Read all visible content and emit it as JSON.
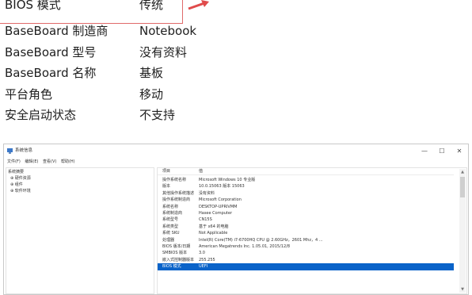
{
  "zoom": {
    "rows": [
      {
        "key": "BIOS 模式",
        "value": "传统"
      },
      {
        "key": "BaseBoard 制造商",
        "value": "Notebook"
      },
      {
        "key": "BaseBoard 型号",
        "value": "没有资料"
      },
      {
        "key": "BaseBoard 名称",
        "value": "基板"
      },
      {
        "key": "平台角色",
        "value": "移动"
      },
      {
        "key": "安全启动状态",
        "value": "不支持"
      }
    ],
    "highlight_color": "#e06a6a"
  },
  "window": {
    "title": "系统信息",
    "controls": {
      "minimize": "—",
      "maximize": "☐",
      "close": "✕"
    },
    "menu": [
      "文件(F)",
      "编辑(E)",
      "查看(V)",
      "帮助(H)"
    ],
    "tree": {
      "root": "系统摘要",
      "children": [
        "⊕ 硬件资源",
        "⊕ 组件",
        "⊕ 软件环境"
      ]
    },
    "table": {
      "header": {
        "item": "项目",
        "value": "值"
      },
      "rows": [
        {
          "item": "操作系统名称",
          "value": "Microsoft Windows 10 专业版"
        },
        {
          "item": "版本",
          "value": "10.0.15063 版本 15063"
        },
        {
          "item": "其他操作系统描述",
          "value": "没有资料"
        },
        {
          "item": "操作系统制造商",
          "value": "Microsoft Corporation"
        },
        {
          "item": "系统名称",
          "value": "DESKTOP-UPRIVMM"
        },
        {
          "item": "系统制造商",
          "value": "Hasee Computer"
        },
        {
          "item": "系统型号",
          "value": "CN15S"
        },
        {
          "item": "系统类型",
          "value": "基于 x64 的电脑"
        },
        {
          "item": "系统 SKU",
          "value": "Not Applicable"
        },
        {
          "item": "处理器",
          "value": "Intel(R) Core(TM) i7-6700HQ CPU @ 2.60GHz，2601 Mhz，4 ..."
        },
        {
          "item": "BIOS 版本/日期",
          "value": "American Megatrends Inc. 1.05.01, 2015/12/8"
        },
        {
          "item": "SMBIOS 版本",
          "value": "3.0"
        },
        {
          "item": "嵌入式控制器版本",
          "value": "255.255"
        },
        {
          "item": "BIOS 模式",
          "value": "UEFI",
          "selected": true
        }
      ]
    },
    "selection_color": "#0a63c9"
  }
}
